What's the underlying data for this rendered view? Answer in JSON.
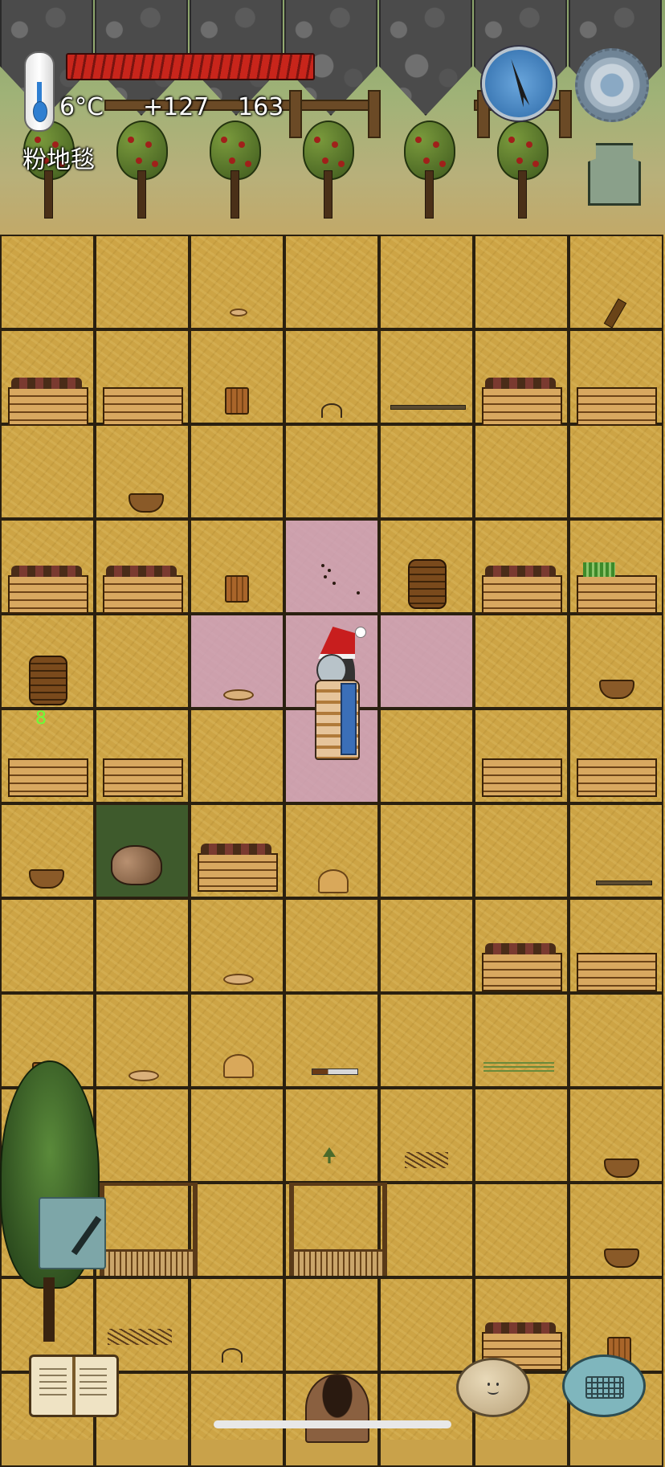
{
  "hud": {
    "temperature": "6°C",
    "yum_bonus": "+127",
    "score": "163",
    "standing_on": "粉地毯",
    "food_bar_fill": 1.0
  },
  "grid_marker": "8",
  "colors": {
    "ground": "#cda445",
    "rug": "#cda0be",
    "food_bar": "#c8251b"
  },
  "icons": {
    "thermometer": "thermometer-icon",
    "compass": "compass-icon",
    "settings": "gear-icon",
    "totem": "totem-icon",
    "note": "pencil-icon",
    "tech_tree": "book-icon",
    "emote": "face-icon",
    "chat": "keyboard-icon"
  }
}
